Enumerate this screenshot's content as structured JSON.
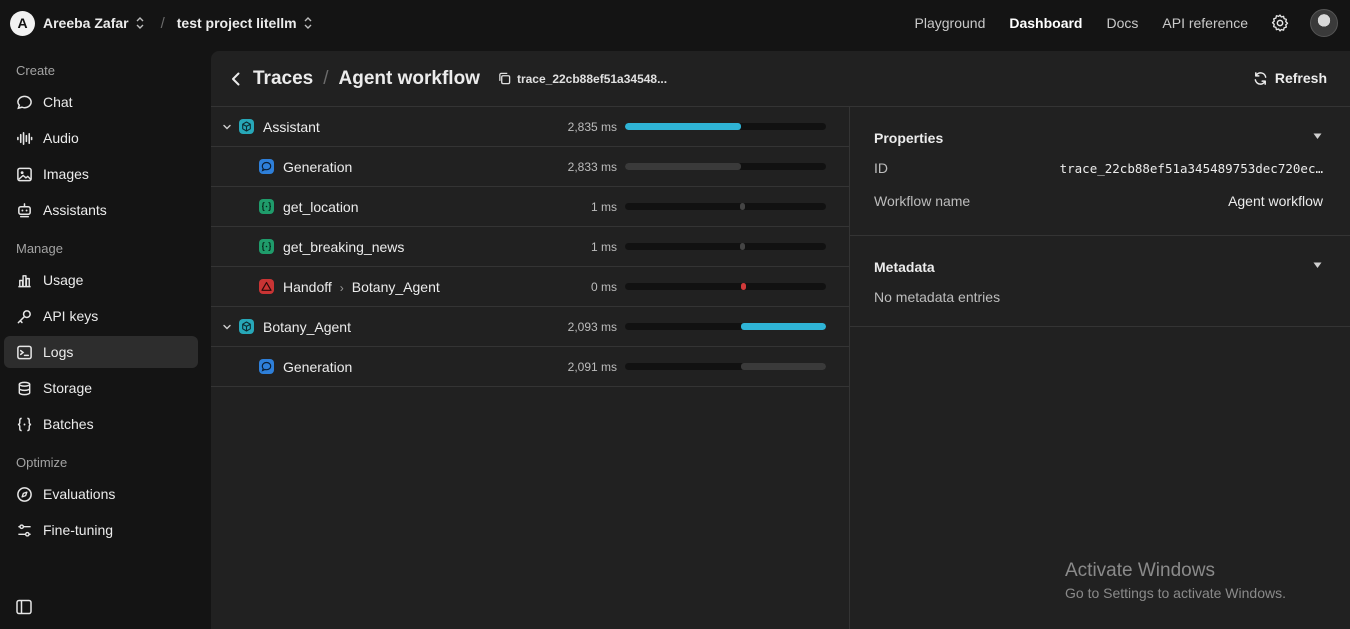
{
  "org": {
    "initial": "A",
    "name": "Areeba Zafar"
  },
  "project": {
    "name": "test project litellm"
  },
  "topnav": [
    "Playground",
    "Dashboard",
    "Docs",
    "API reference"
  ],
  "active_nav": "Dashboard",
  "sidebar": {
    "sections": [
      {
        "label": "Create",
        "items": [
          {
            "label": "Chat",
            "icon": "chat-icon"
          },
          {
            "label": "Audio",
            "icon": "audio-icon"
          },
          {
            "label": "Images",
            "icon": "image-icon"
          },
          {
            "label": "Assistants",
            "icon": "robot-icon"
          }
        ]
      },
      {
        "label": "Manage",
        "items": [
          {
            "label": "Usage",
            "icon": "bar-chart-icon"
          },
          {
            "label": "API keys",
            "icon": "key-icon"
          },
          {
            "label": "Logs",
            "icon": "terminal-icon"
          },
          {
            "label": "Storage",
            "icon": "database-icon"
          },
          {
            "label": "Batches",
            "icon": "braces-icon"
          }
        ]
      },
      {
        "label": "Optimize",
        "items": [
          {
            "label": "Evaluations",
            "icon": "compass-icon"
          },
          {
            "label": "Fine-tuning",
            "icon": "sliders-icon"
          }
        ]
      }
    ],
    "active_item": "Logs"
  },
  "header": {
    "breadcrumb": "Traces",
    "title": "Agent workflow",
    "trace_id_short": "trace_22cb88ef51a34548...",
    "refresh_label": "Refresh"
  },
  "spans": [
    {
      "name": "Assistant",
      "type": "agent",
      "duration": "2,835 ms",
      "expanded": true,
      "level": 0,
      "start": 0.0,
      "end": 0.575,
      "color": "#2fb4d6"
    },
    {
      "name": "Generation",
      "type": "generation",
      "duration": "2,833 ms",
      "level": 1,
      "start": 0.0,
      "end": 0.575,
      "color": "#3a3a3a"
    },
    {
      "name": "get_location",
      "type": "function",
      "duration": "1 ms",
      "level": 1,
      "start": 0.57,
      "end": 0.59,
      "color": "#444444"
    },
    {
      "name": "get_breaking_news",
      "type": "function",
      "duration": "1 ms",
      "level": 1,
      "start": 0.57,
      "end": 0.59,
      "color": "#444444"
    },
    {
      "name": "Handoff",
      "target": "Botany_Agent",
      "type": "handoff",
      "duration": "0 ms",
      "level": 1,
      "start": 0.575,
      "end": 0.59,
      "color": "#d13a3a"
    },
    {
      "name": "Botany_Agent",
      "type": "agent",
      "duration": "2,093 ms",
      "expanded": true,
      "level": 0,
      "start": 0.575,
      "end": 1.0,
      "color": "#2fb4d6"
    },
    {
      "name": "Generation",
      "type": "generation",
      "duration": "2,091 ms",
      "level": 1,
      "start": 0.575,
      "end": 1.0,
      "color": "#3a3a3a"
    }
  ],
  "properties": {
    "title": "Properties",
    "fields": [
      {
        "label": "ID",
        "value": "trace_22cb88ef51a345489753dec720ec…"
      },
      {
        "label": "Workflow name",
        "value": "Agent workflow"
      }
    ]
  },
  "metadata": {
    "title": "Metadata",
    "empty": "No metadata entries"
  },
  "watermark": {
    "line1": "Activate Windows",
    "line2": "Go to Settings to activate Windows."
  },
  "colors": {
    "accent": "#2fb4d6",
    "handoff": "#d13a3a",
    "generation_icon": "#2e7fd9",
    "function_icon": "#1f9c6b",
    "agent_icon": "#27a7b8"
  }
}
